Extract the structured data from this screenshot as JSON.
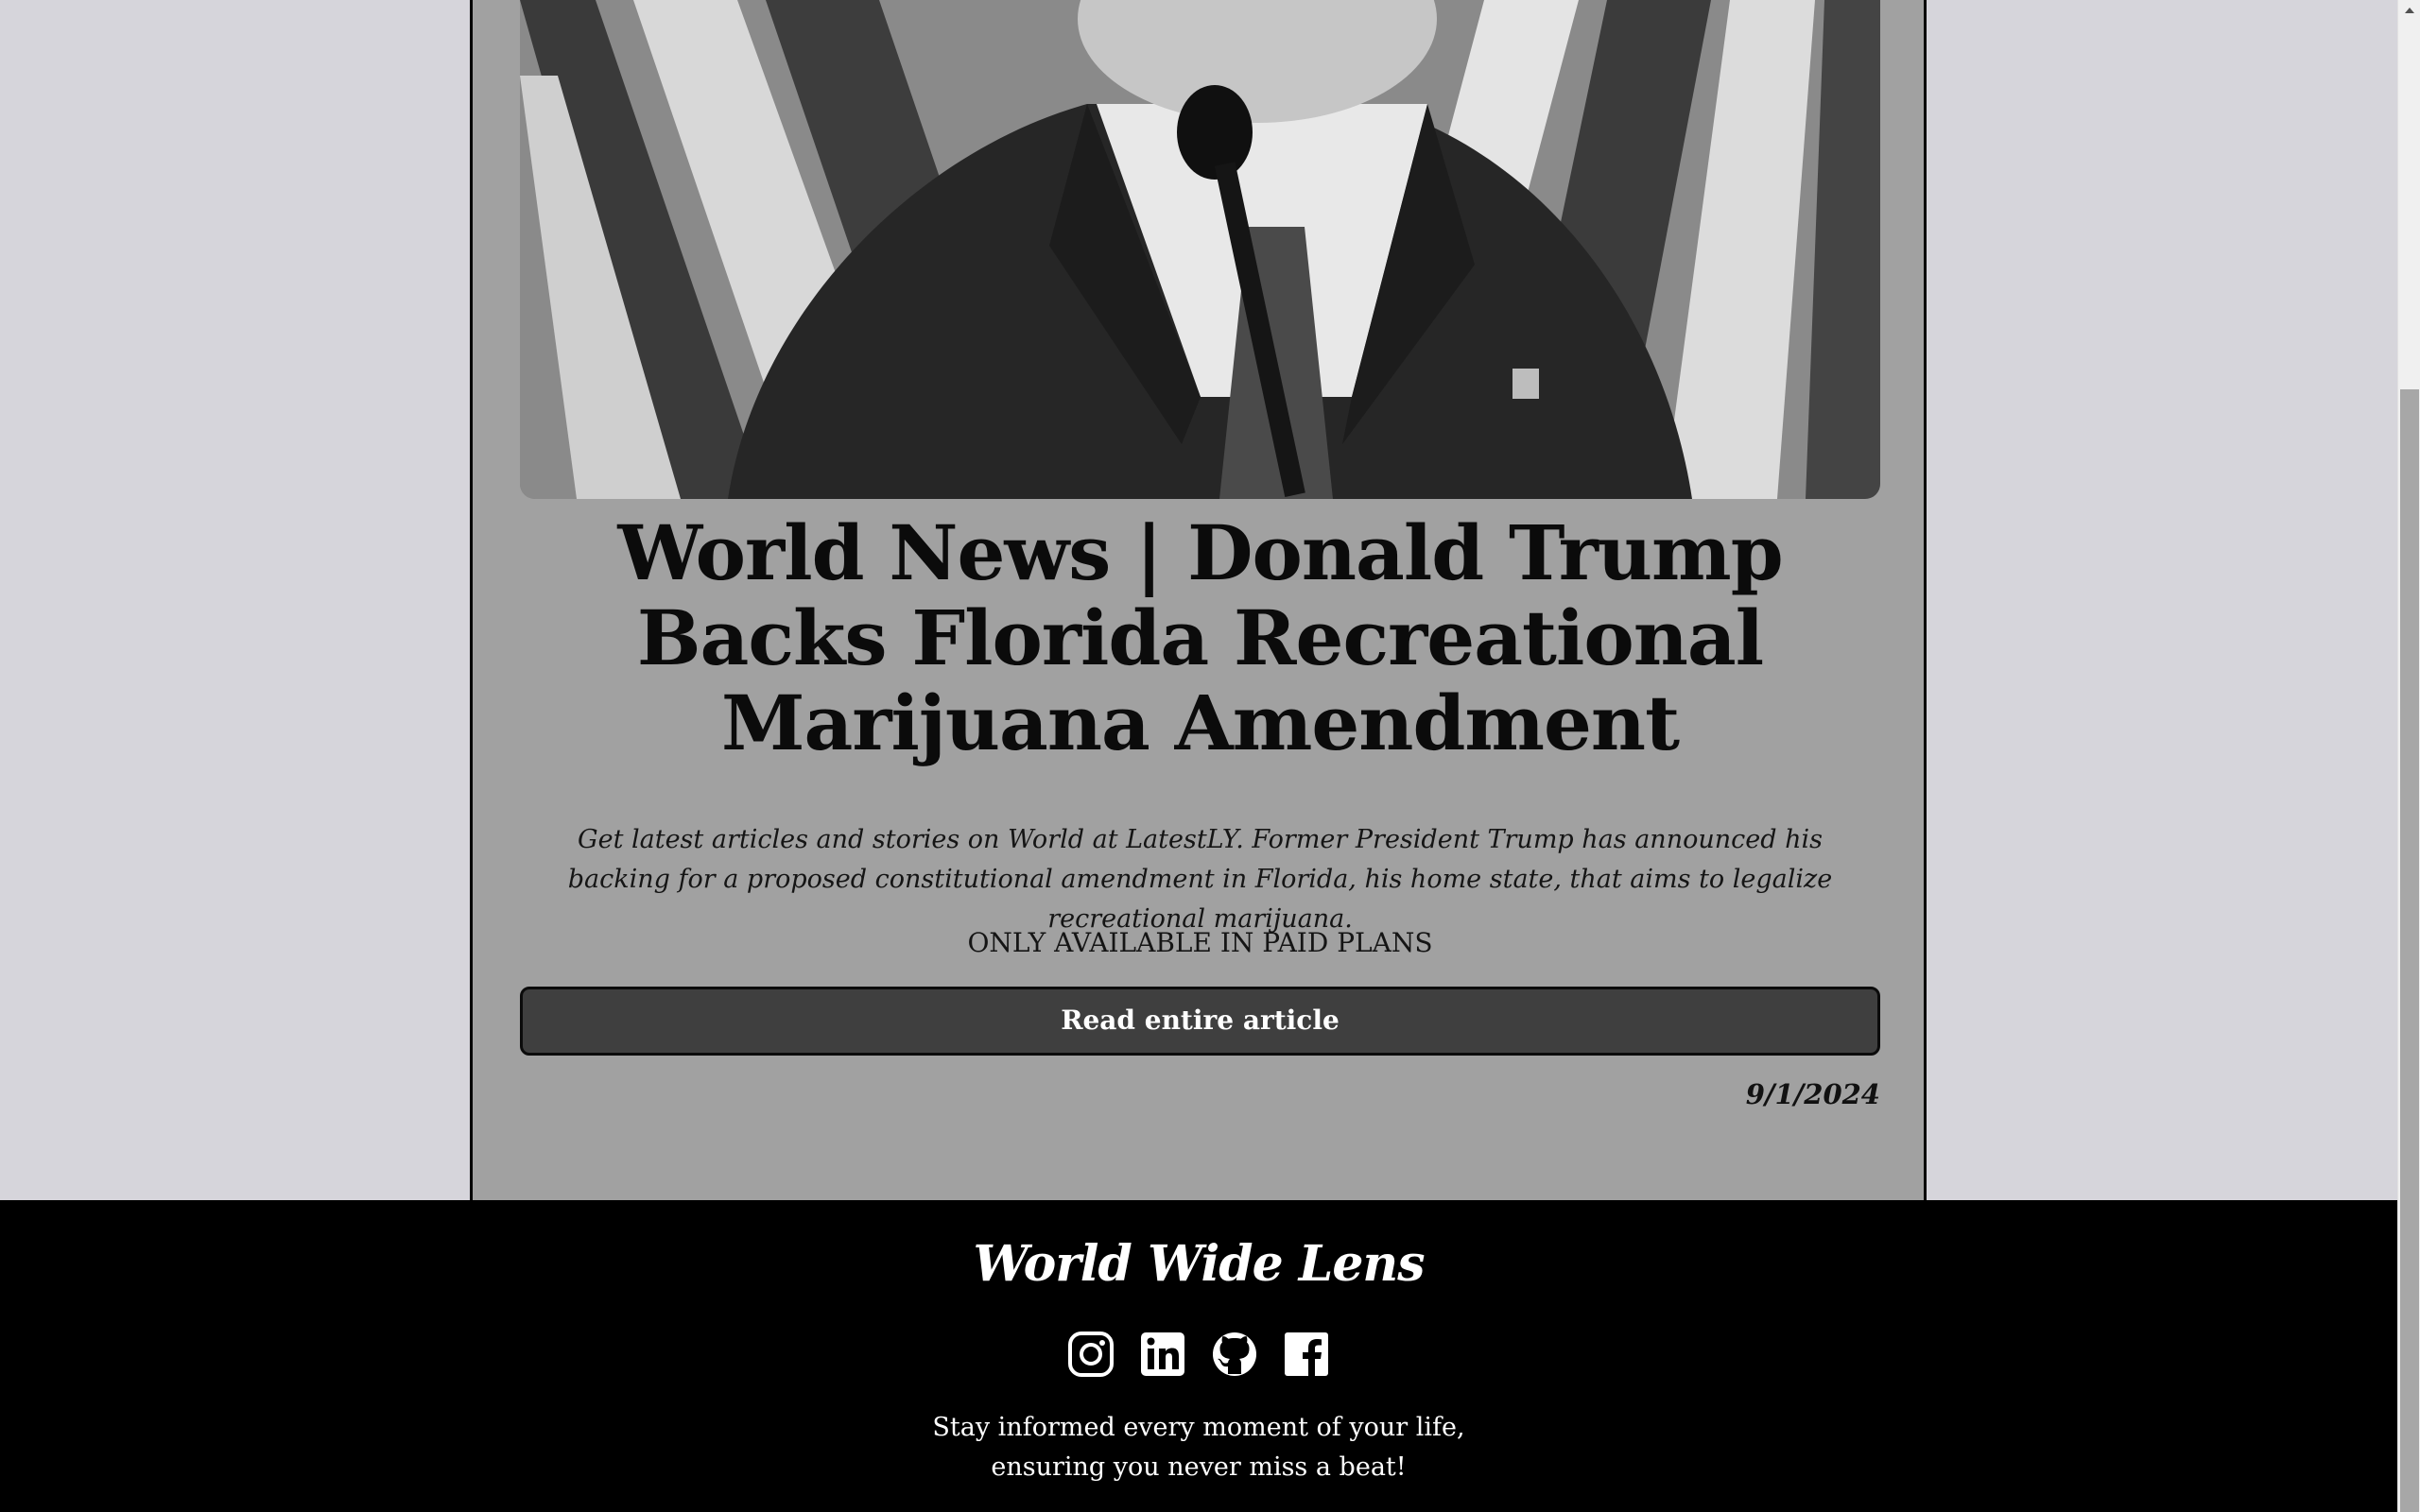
{
  "article": {
    "image_alt": "Donald Trump speaking into a microphone in front of a flag",
    "headline": "World News | Donald Trump Backs Florida Recreational Marijuana Amendment",
    "summary": "Get latest articles and stories on World at LatestLY. Former President Trump has announced his backing for a proposed constitutional amendment in Florida, his home state, that aims to legalize recreational marijuana.",
    "paid_note": "ONLY AVAILABLE IN PAID PLANS",
    "read_button": "Read entire article",
    "date": "9/1/2024"
  },
  "footer": {
    "brand": "World Wide Lens",
    "socials": [
      {
        "icon": "instagram-icon"
      },
      {
        "icon": "linkedin-icon"
      },
      {
        "icon": "github-icon"
      },
      {
        "icon": "facebook-icon"
      }
    ],
    "tagline": "Stay informed every moment of your life, ensuring you never miss a beat!"
  },
  "colors": {
    "page_bg": "#d6d5db",
    "card_bg": "#a1a1a1",
    "button_bg": "#3f3f3f",
    "footer_bg": "#000000",
    "text_dark": "#0b0b0b",
    "text_light": "#ffffff"
  }
}
